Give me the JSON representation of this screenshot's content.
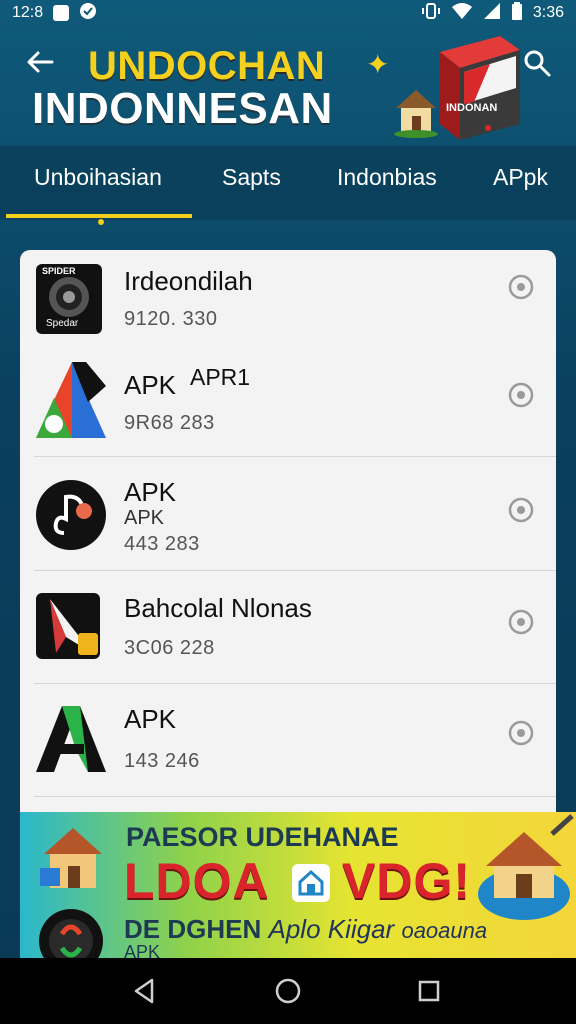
{
  "status_bar": {
    "time": "12:8",
    "clock_right": "3:36",
    "icons_left": [
      "notification-square-icon",
      "shield-icon"
    ],
    "icons_right": [
      "vibrate-icon",
      "wifi-icon",
      "signal-icon",
      "battery-icon"
    ]
  },
  "header": {
    "back_icon": "arrow-left-icon",
    "title_line1": "UNDOCHAN",
    "title_line2": "INDONNESAN",
    "box_label": "INDONAN",
    "search_icon": "search-icon"
  },
  "tabs": [
    {
      "label": "Unboihasian",
      "active": true
    },
    {
      "label": "Sapts",
      "active": false
    },
    {
      "label": "Indonbias",
      "active": false
    },
    {
      "label": "APpk",
      "active": false
    }
  ],
  "apps": [
    {
      "icon": "camera-lens-icon",
      "icon_top_text": "SPIDER",
      "icon_bottom_text": "Spedar",
      "title": "Irdeondilah",
      "title2": "",
      "subtitle": "",
      "meta": "9120. 330"
    },
    {
      "icon": "triangle-play-icon",
      "title": "APK",
      "title2": "APR1",
      "subtitle": "",
      "meta": "9R68 283"
    },
    {
      "icon": "music-note-icon",
      "title": "APK",
      "title2": "",
      "subtitle": "APK",
      "meta": "443 283"
    },
    {
      "icon": "folder-arrow-icon",
      "title": "Bahcolal Nlonas",
      "title2": "",
      "subtitle": "",
      "meta": "3C06 228"
    },
    {
      "icon": "letter-a-icon",
      "title": "APK",
      "title2": "",
      "subtitle": "",
      "meta": "143 246"
    }
  ],
  "banner": {
    "line1": "PAESOR UDEHANAE",
    "line2a": "LDOA",
    "line2b": "VDG!",
    "line3a": "DE DGHEN",
    "line3b": "Aplo Kiigar",
    "line3c": "oaoauna",
    "line4": "APK"
  },
  "nav": [
    "back-triangle-icon",
    "home-circle-icon",
    "recents-square-icon"
  ],
  "colors": {
    "accent": "#f2cf1d",
    "header_bg": "#0f5a7a",
    "card_bg": "#f3f3f3"
  }
}
